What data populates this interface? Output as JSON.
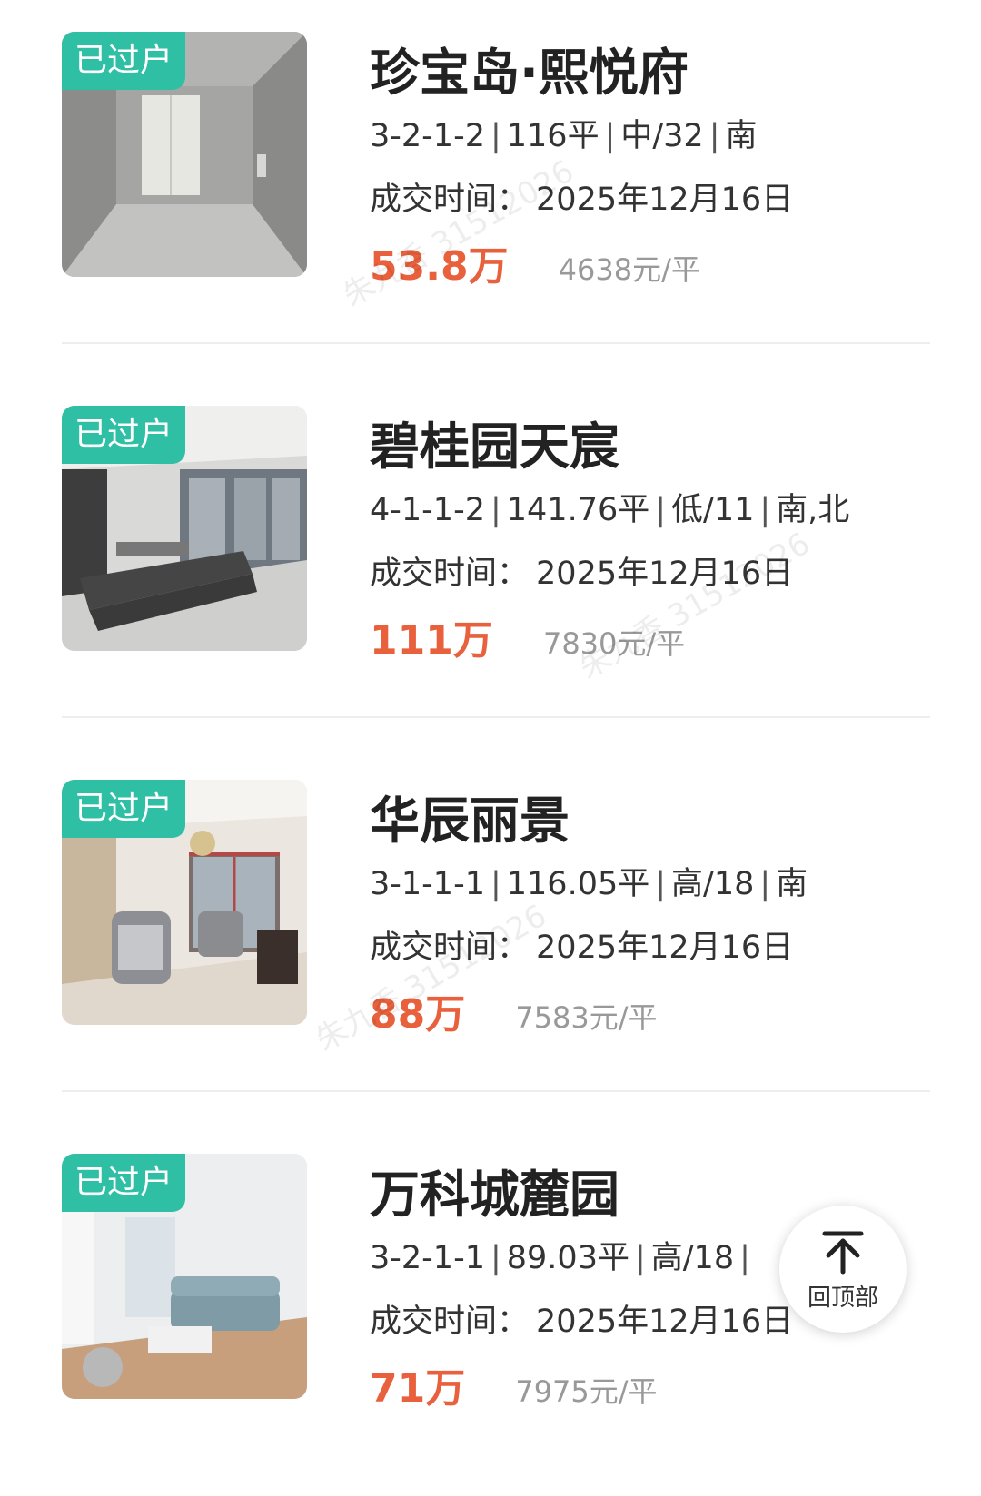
{
  "listings": [
    {
      "badge": "已过户",
      "name": "珍宝岛·熙悦府",
      "layout": "3-2-1-2",
      "area": "116平",
      "floor": "中/32",
      "orientation": "南",
      "deal_label": "成交时间",
      "deal_date": "2025年12月16日",
      "price": "53.8万",
      "unit_price": "4638元/平"
    },
    {
      "badge": "已过户",
      "name": "碧桂园天宸",
      "layout": "4-1-1-2",
      "area": "141.76平",
      "floor": "低/11",
      "orientation": "南,北",
      "deal_label": "成交时间",
      "deal_date": "2025年12月16日",
      "price": "111万",
      "unit_price": "7830元/平"
    },
    {
      "badge": "已过户",
      "name": "华辰丽景",
      "layout": "3-1-1-1",
      "area": "116.05平",
      "floor": "高/18",
      "orientation": "南",
      "deal_label": "成交时间",
      "deal_date": "2025年12月16日",
      "price": "88万",
      "unit_price": "7583元/平"
    },
    {
      "badge": "已过户",
      "name": "万科城麓园",
      "layout": "3-2-1-1",
      "area": "89.03平",
      "floor": "高/18",
      "orientation": "",
      "deal_label": "成交时间",
      "deal_date": "2025年12月16日",
      "price": "71万",
      "unit_price": "7975元/平"
    }
  ],
  "separator": "|",
  "colon": "：",
  "back_to_top": {
    "label": "回顶部",
    "icon": "arrow-up-to-top-icon"
  },
  "watermark": {
    "name": "朱九香",
    "id": "31512026"
  },
  "colors": {
    "badge": "#2ebfa5",
    "price": "#e8603c",
    "unit_price": "#999999"
  }
}
